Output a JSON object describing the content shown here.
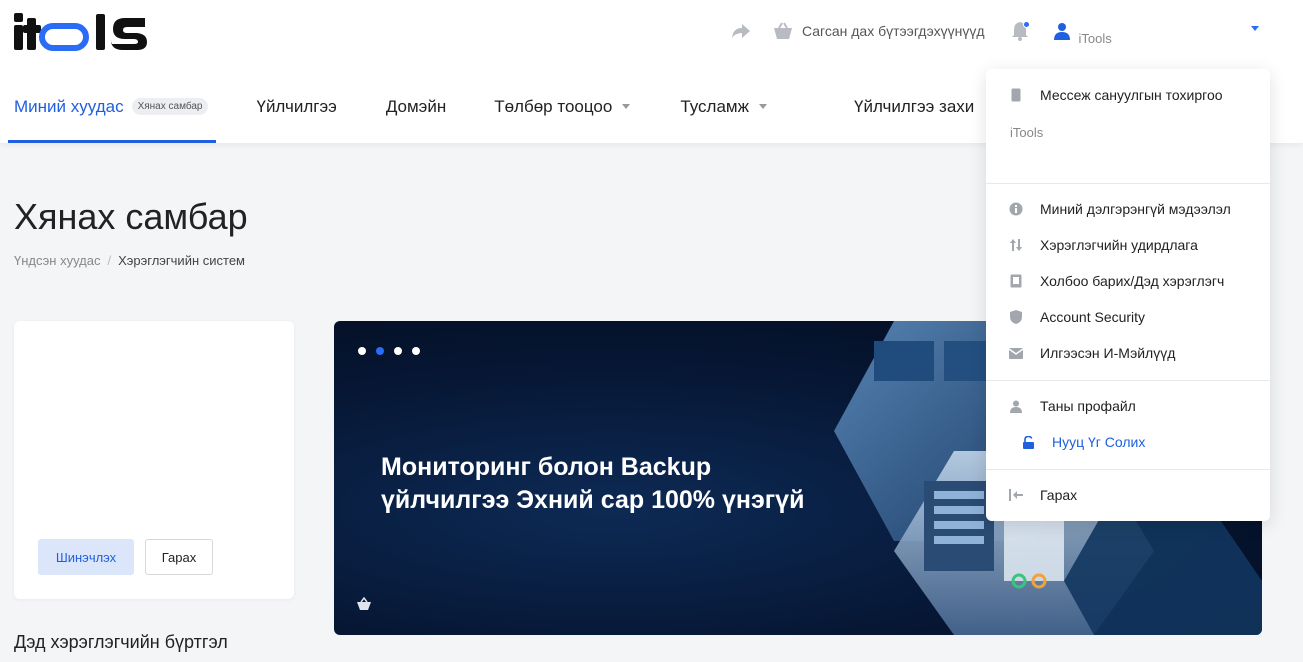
{
  "brand": {
    "logo_text": "itools",
    "accent": "#1f5fe0"
  },
  "header": {
    "cart_label": "Сагсан дах бүтээгдэхүүнүүд",
    "user_name": "iTools"
  },
  "nav": {
    "items": [
      {
        "label": "Миний хуудас",
        "badge": "Хянах самбар",
        "active": true
      },
      {
        "label": "Үйлчилгээ"
      },
      {
        "label": "Домэйн"
      },
      {
        "label": "Төлбөр тооцоо",
        "dropdown": true
      },
      {
        "label": "Тусламж",
        "dropdown": true
      },
      {
        "label": "Үйлчилгээ захи"
      }
    ]
  },
  "page": {
    "title": "Хянах самбар",
    "breadcrumb": [
      "Үндсэн хуудас",
      "Хэрэглэгчийн систем"
    ]
  },
  "card": {
    "refresh_label": "Шинэчлэх",
    "logout_label": "Гарах"
  },
  "section_heading": "Дэд хэрэглэгчийн бүртгэл",
  "banner": {
    "line1": "Мониторинг болон Backup",
    "line2": "үйлчилгээ Эхний сар 100% үнэгүй",
    "slides": 4,
    "active_slide": 2
  },
  "dropdown": {
    "message_settings": "Мессеж сануулгын тохиргоо",
    "org_name": "iTools",
    "items": [
      "Миний дэлгэрэнгүй мэдээлэл",
      "Хэрэглэгчийн удирдлага",
      "Холбоо барих/Дэд хэрэглэгч",
      "Account Security",
      "Илгээсэн И-Мэйлүүд"
    ],
    "profile": "Таны профайл",
    "change_password": "Нууц Үг Солих",
    "logout": "Гарах"
  }
}
